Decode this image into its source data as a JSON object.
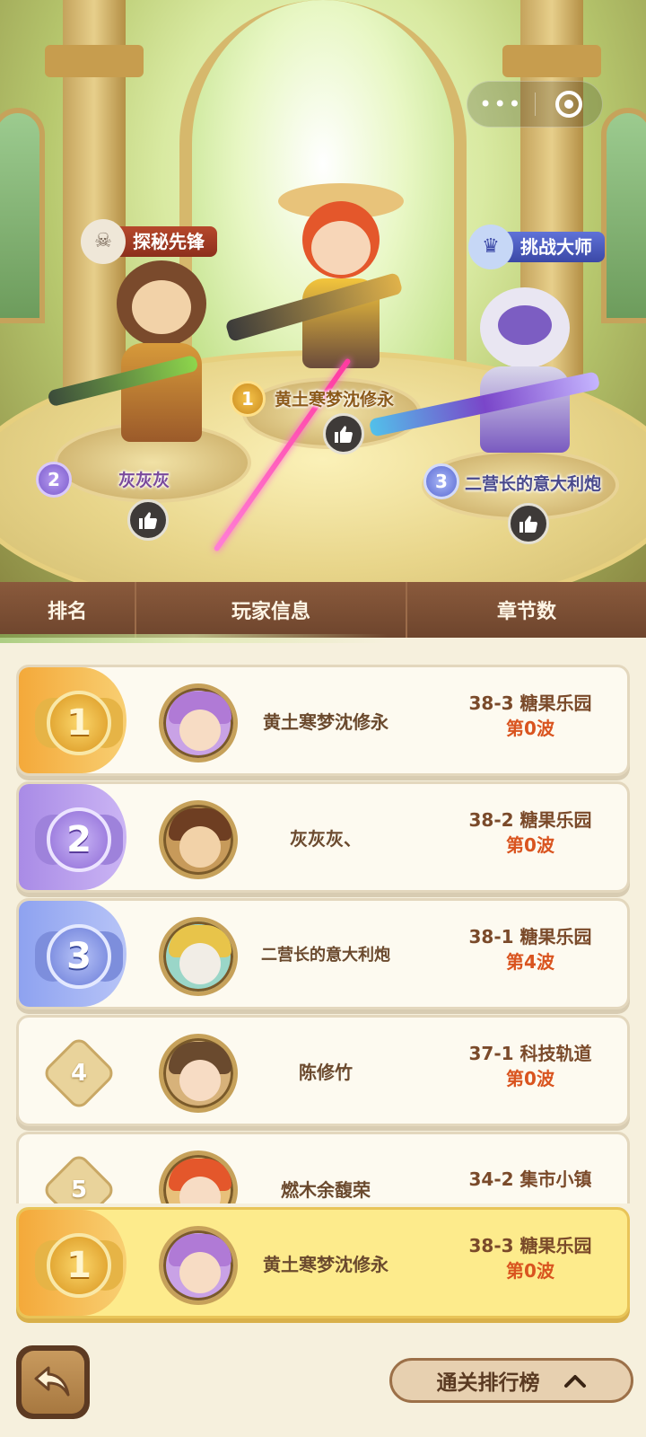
{
  "capsule": {
    "more_glyph": "•••",
    "close_icon": "target-icon"
  },
  "podium": [
    {
      "rank": "1",
      "name": "黄土寒梦沈修永",
      "title": ""
    },
    {
      "rank": "2",
      "name": "灰灰灰",
      "title": "探秘先锋"
    },
    {
      "rank": "3",
      "name": "二营长的意大利炮",
      "title": "挑战大师"
    }
  ],
  "header": {
    "rank": "排名",
    "player": "玩家信息",
    "chapter": "章节数"
  },
  "rows": [
    {
      "rank": "1",
      "name": "黄土寒梦沈修永",
      "chapter": "38-3 糖果乐园",
      "wave": "第0波"
    },
    {
      "rank": "2",
      "name": "灰灰灰、",
      "chapter": "38-2 糖果乐园",
      "wave": "第0波"
    },
    {
      "rank": "3",
      "name": "二营长的意大利炮",
      "chapter": "38-1 糖果乐园",
      "wave": "第4波"
    },
    {
      "rank": "4",
      "name": "陈修竹",
      "chapter": "37-1 科技轨道",
      "wave": "第0波"
    },
    {
      "rank": "5",
      "name": "燃木余馥荣",
      "chapter": "34-2 集市小镇",
      "wave": ""
    }
  ],
  "my_rank": {
    "rank": "1",
    "name": "黄土寒梦沈修永",
    "chapter": "38-3 糖果乐园",
    "wave": "第0波"
  },
  "footer": {
    "leaderboard_toggle": "通关排行榜"
  },
  "colors": {
    "gold": "#f0b34a",
    "purple": "#a98be6",
    "blue": "#8ea2f0",
    "brown": "#7a4a2a",
    "orange": "#d9541f"
  }
}
